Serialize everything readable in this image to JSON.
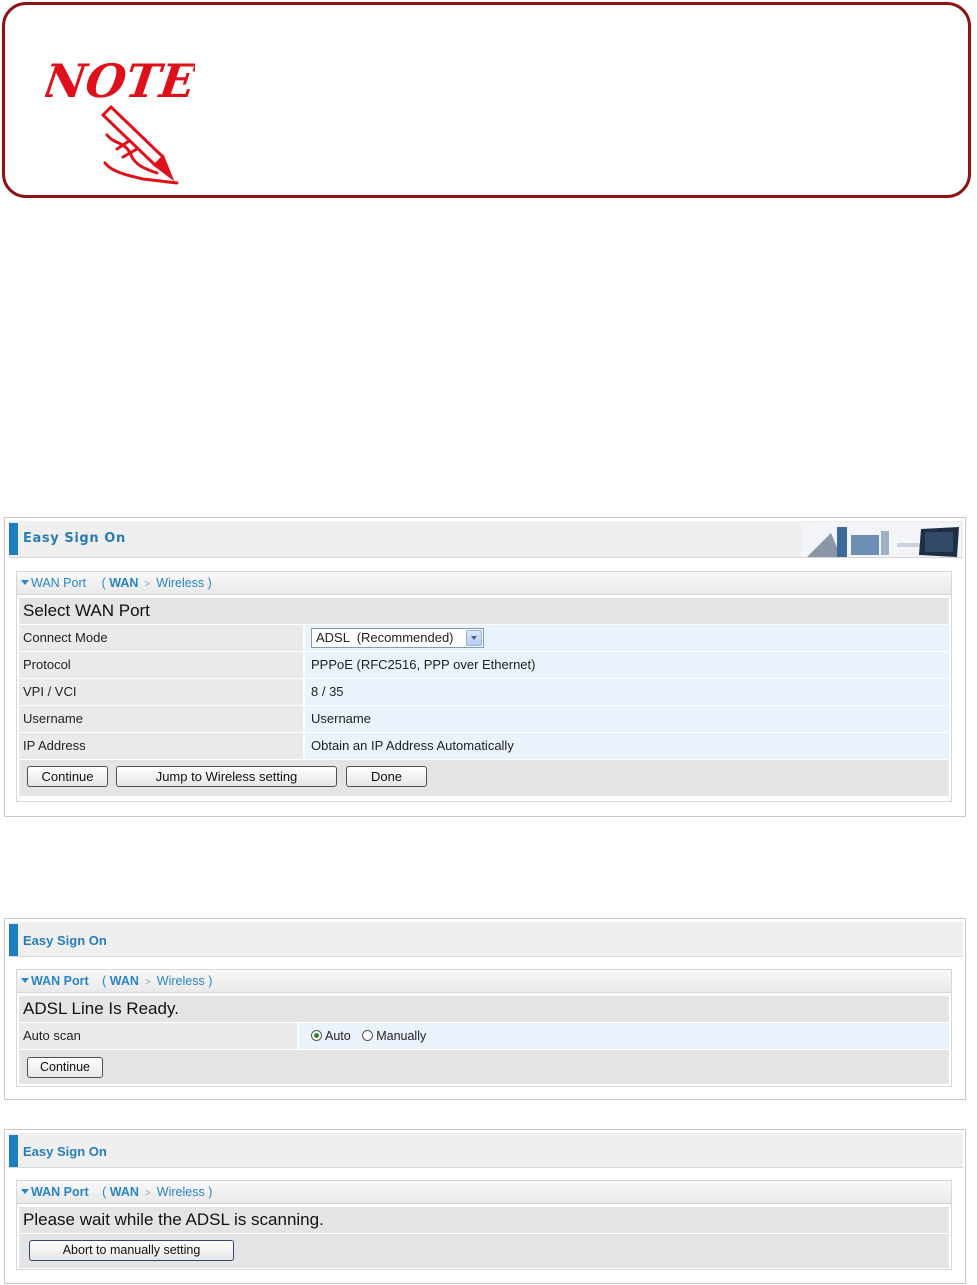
{
  "note": {
    "logo_text": "NOTE:"
  },
  "colors": {
    "accent": "#1b7fc4",
    "note_border": "#8c1414",
    "note_text": "#e0101a",
    "link": "#2a85c4"
  },
  "panel1": {
    "header_title": "Easy Sign On",
    "breadcrumb": {
      "current": "WAN Port",
      "open": "(",
      "step1": "WAN",
      "sep": ">",
      "step2": "Wireless",
      "close": ")"
    },
    "section_title": "Select WAN Port",
    "rows": [
      {
        "label": "Connect Mode",
        "value": "ADSL  (Recommended)"
      },
      {
        "label": "Protocol",
        "value": "PPPoE (RFC2516, PPP over Ethernet)"
      },
      {
        "label": "VPI / VCI",
        "value": "8 / 35"
      },
      {
        "label": "Username",
        "value": "Username"
      },
      {
        "label": "IP Address",
        "value": "Obtain an IP Address Automatically"
      }
    ],
    "buttons": {
      "continue": "Continue",
      "jump": "Jump to Wireless setting",
      "done": "Done"
    }
  },
  "panel2": {
    "header_title": "Easy Sign On",
    "breadcrumb": {
      "current": "WAN Port",
      "open": "(",
      "step1": "WAN",
      "sep": ">",
      "step2": "Wireless",
      "close": ")"
    },
    "section_title": "ADSL Line Is Ready.",
    "auto_scan": {
      "label": "Auto scan",
      "option_auto": "Auto",
      "option_manual": "Manually",
      "selected": "Auto"
    },
    "buttons": {
      "continue": "Continue"
    }
  },
  "panel3": {
    "header_title": "Easy Sign On",
    "breadcrumb": {
      "current": "WAN Port",
      "open": "(",
      "step1": "WAN",
      "sep": ">",
      "step2": "Wireless",
      "close": ")"
    },
    "section_title": "Please wait while the ADSL is scanning.",
    "buttons": {
      "abort": "Abort to manually setting"
    }
  }
}
